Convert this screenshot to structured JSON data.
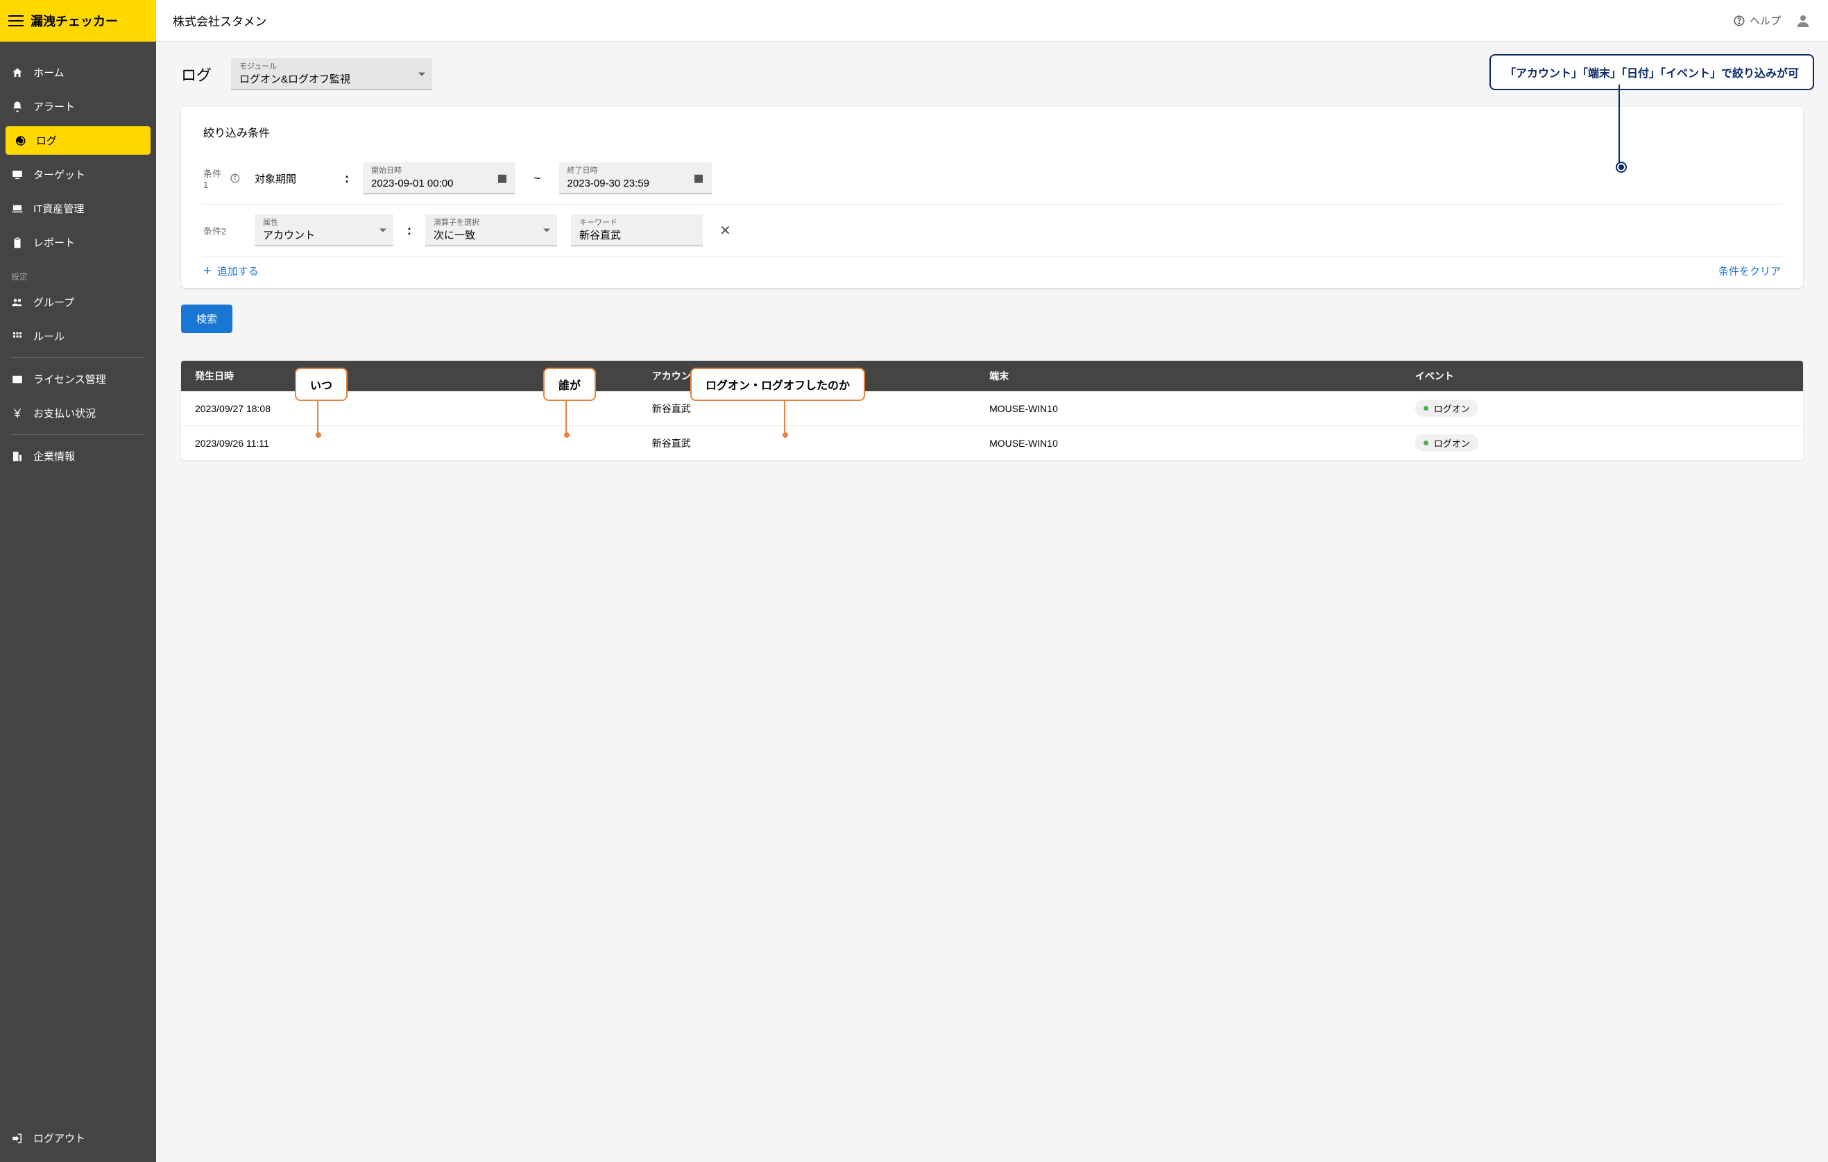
{
  "app_title": "漏洩チェッカー",
  "company": "株式会社スタメン",
  "help": "ヘルプ",
  "sidebar": {
    "items": [
      {
        "label": "ホーム",
        "icon": "home"
      },
      {
        "label": "アラート",
        "icon": "bell"
      },
      {
        "label": "ログ",
        "icon": "history",
        "active": true
      },
      {
        "label": "ターゲット",
        "icon": "monitor-user"
      },
      {
        "label": "IT資産管理",
        "icon": "laptop"
      },
      {
        "label": "レポート",
        "icon": "clipboard"
      }
    ],
    "settings_heading": "設定",
    "settings_items": [
      {
        "label": "グループ",
        "icon": "group"
      },
      {
        "label": "ルール",
        "icon": "grid"
      }
    ],
    "admin_items": [
      {
        "label": "ライセンス管理",
        "icon": "card"
      },
      {
        "label": "お支払い状況",
        "icon": "yen"
      }
    ],
    "company_item": {
      "label": "企業情報",
      "icon": "building"
    },
    "logout": "ログアウト"
  },
  "page": {
    "title": "ログ",
    "module": {
      "label": "モジュール",
      "value": "ログオン&ログオフ監視"
    }
  },
  "filter": {
    "title": "絞り込み条件",
    "cond1": {
      "label": "条件1",
      "name": "対象期間",
      "start": {
        "label": "開始日時",
        "value": "2023-09-01 00:00"
      },
      "tilde": "~",
      "end": {
        "label": "終了日時",
        "value": "2023-09-30 23:59"
      }
    },
    "cond2": {
      "label": "条件2",
      "attr": {
        "label": "属性",
        "value": "アカウント"
      },
      "op": {
        "label": "演算子を選択",
        "value": "次に一致"
      },
      "kw": {
        "label": "キーワード",
        "value": "新谷直武"
      }
    },
    "add": "追加する",
    "clear": "条件をクリア",
    "search": "検索"
  },
  "table": {
    "headers": [
      "発生日時",
      "アカウント",
      "端末",
      "イベント"
    ],
    "rows": [
      {
        "dt": "2023/09/27 18:08",
        "acct": "新谷直武",
        "term": "MOUSE-WIN10",
        "evt": "ログオン"
      },
      {
        "dt": "2023/09/26 11:11",
        "acct": "新谷直武",
        "term": "MOUSE-WIN10",
        "evt": "ログオン"
      }
    ]
  },
  "annot": {
    "blue": "「アカウント」「端末」「日付」「イベント」で絞り込みが可",
    "when": "いつ",
    "who": "誰が",
    "what": "ログオン・ログオフしたのか"
  }
}
